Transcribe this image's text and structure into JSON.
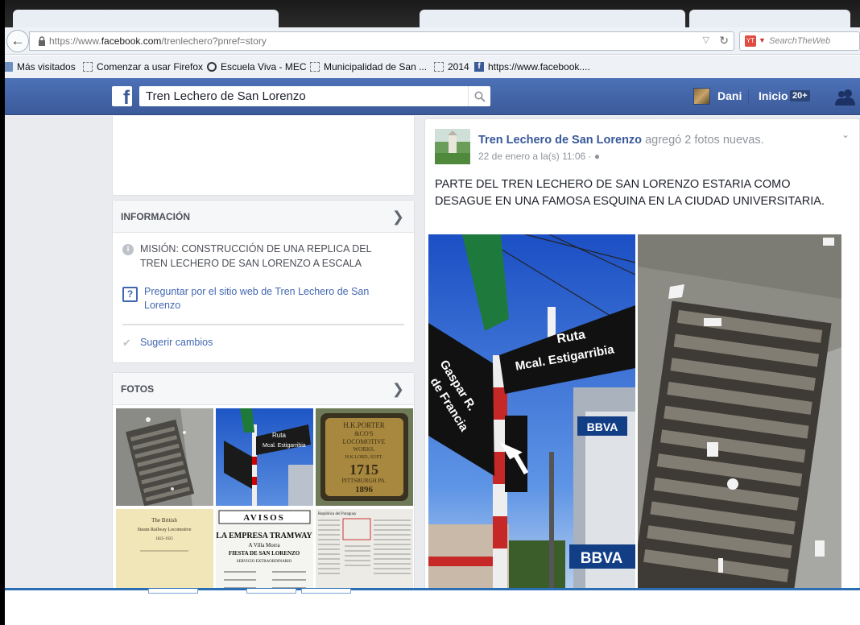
{
  "browser": {
    "url_prefix": "https://www.",
    "url_domain": "facebook.com",
    "url_path": "/trenlechero?pnref=story",
    "search_placeholder": "SearchTheWeb"
  },
  "bookmarks": [
    {
      "label": "Más visitados",
      "icon": "folder-icon"
    },
    {
      "label": "Comenzar a usar Firefox",
      "icon": "blank-page-icon"
    },
    {
      "label": "Escuela Viva - MEC",
      "icon": "escuela-icon"
    },
    {
      "label": "Municipalidad de San ...",
      "icon": "blank-page-icon"
    },
    {
      "label": "2014",
      "icon": "blank-page-icon"
    },
    {
      "label": "https://www.facebook....",
      "icon": "facebook-icon"
    }
  ],
  "facebook": {
    "logo": "f",
    "search_value": "Tren Lechero de San Lorenzo",
    "user_name": "Dani",
    "home_label": "Inicio",
    "home_count": "20+"
  },
  "info": {
    "heading": "INFORMACIÓN",
    "mission": "MISIÓN: CONSTRUCCIÓN DE UNA REPLICA DEL TREN LECHERO DE SAN LORENZO A ESCALA",
    "ask_website": "Preguntar por el sitio web de Tren Lechero de San Lorenzo",
    "suggest": "Sugerir cambios"
  },
  "photos": {
    "heading": "FOTOS",
    "plate": {
      "line1": "H.K.PORTER",
      "line2": "&CO'S",
      "line3": "LOCOMOTIVE",
      "line4": "WORKS.",
      "line5": "H.K.LORD, SUPT.",
      "number": "1715",
      "city": "PITTSBURGH PA.",
      "year": "1896"
    },
    "book": {
      "line1": "The British",
      "line2": "Steam Railway Locomotive",
      "years": "1825-1925"
    },
    "avisos": {
      "title": "AVISOS",
      "line1": "LA EMPRESA TRAMWAY",
      "line2": "A Villa Morra",
      "line3": "FIESTA DE SAN LORENZO",
      "line4": "SERVICIO EXTRAORDINARIO"
    },
    "newspaper": "República del Paraguay"
  },
  "post": {
    "page_name": "Tren Lechero de San Lorenzo",
    "action": "agregó 2 fotos nuevas.",
    "date": "22 de enero a la(s) 11:06",
    "text": "PARTE DEL TREN LECHERO DE SAN LORENZO ESTARIA COMO DESAGUE EN UNA FAMOSA ESQUINA EN LA CIUDAD UNIVERSITARIA.",
    "sign_ruta_1": "Ruta",
    "sign_ruta_2": "Mcal. Estigarribia",
    "sign_gaspar_1": "Gaspar R.",
    "sign_gaspar_2": "de Francia",
    "bank_sign": "BBVA"
  },
  "colors": {
    "facebook_blue": "#4267b2",
    "link_blue": "#365899",
    "page_bg": "#e9ebee"
  }
}
